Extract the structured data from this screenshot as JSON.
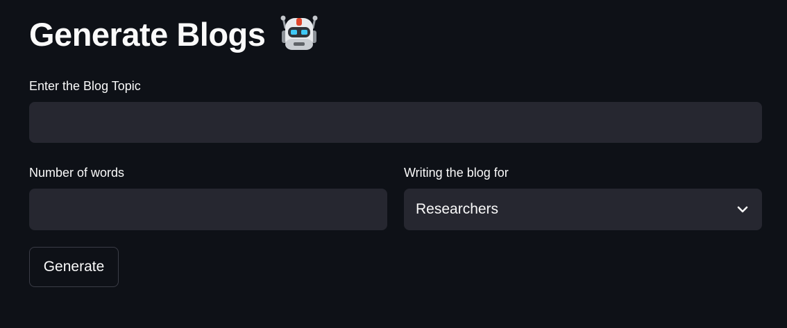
{
  "page": {
    "title": "Generate Blogs",
    "title_icon": "robot-icon"
  },
  "topic": {
    "label": "Enter the Blog Topic",
    "value": "",
    "placeholder": ""
  },
  "words": {
    "label": "Number of words",
    "value": "",
    "placeholder": ""
  },
  "audience": {
    "label": "Writing the blog for",
    "selected": "Researchers"
  },
  "actions": {
    "generate_label": "Generate"
  },
  "colors": {
    "background": "#0e1117",
    "field_background": "#262730",
    "text": "#fafafa",
    "button_border": "#3b3d47"
  }
}
